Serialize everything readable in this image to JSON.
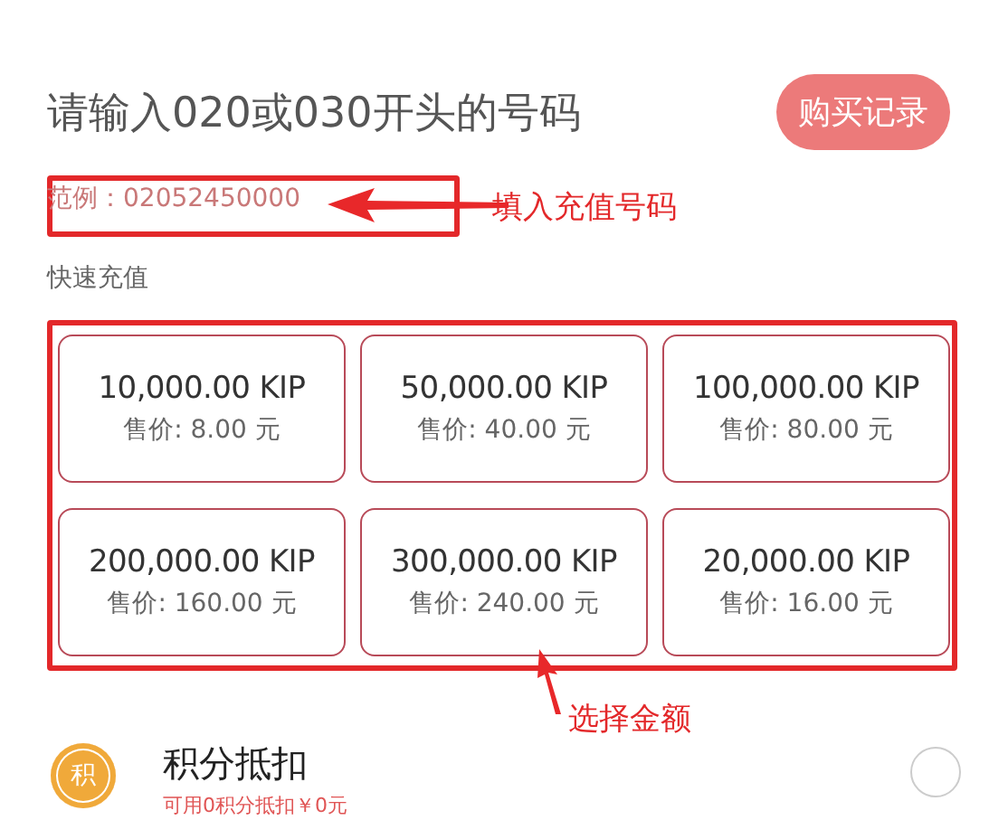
{
  "header": {
    "title": "请输入020或030开头的号码",
    "button": "购买记录"
  },
  "example": "范例：02052450000",
  "quick_label": "快速充值",
  "options": [
    {
      "amount": "10,000.00 KIP",
      "price": "售价: 8.00 元"
    },
    {
      "amount": "50,000.00 KIP",
      "price": "售价: 40.00 元"
    },
    {
      "amount": "100,000.00 KIP",
      "price": "售价: 80.00 元"
    },
    {
      "amount": "200,000.00 KIP",
      "price": "售价: 160.00 元"
    },
    {
      "amount": "300,000.00 KIP",
      "price": "售价: 240.00 元"
    },
    {
      "amount": "20,000.00 KIP",
      "price": "售价: 16.00 元"
    }
  ],
  "points": {
    "icon": "积",
    "title": "积分抵扣",
    "checked": false,
    "note": "可用0积分抵扣￥0元"
  },
  "annotations": [
    {
      "text": "填入充值号码"
    },
    {
      "text": "选择金额"
    }
  ]
}
